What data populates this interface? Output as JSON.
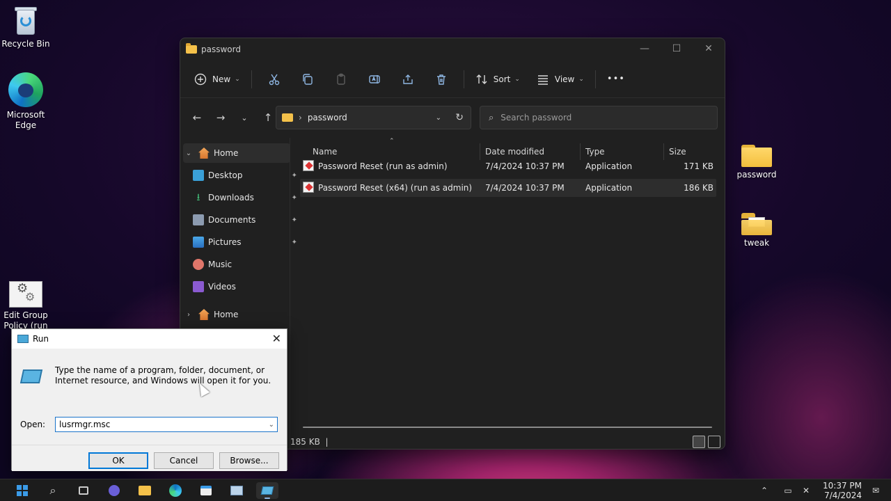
{
  "desktop": {
    "icons": [
      {
        "label": "Recycle Bin"
      },
      {
        "label": "Microsoft Edge"
      },
      {
        "label": "Edit Group Policy (run"
      },
      {
        "label": "password"
      },
      {
        "label": "tweak"
      }
    ]
  },
  "explorer": {
    "title": "password",
    "window_controls": {
      "minimize": "—",
      "maximize": "☐",
      "close": "✕"
    },
    "toolbar": {
      "new_label": "New",
      "sort_label": "Sort",
      "view_label": "View",
      "more_label": "•••"
    },
    "address": {
      "crumb": "password"
    },
    "search": {
      "placeholder": "Search password"
    },
    "sidebar": {
      "items": [
        {
          "label": "Home",
          "icon": "home-icon"
        },
        {
          "label": "Desktop",
          "icon": "desktop-icon"
        },
        {
          "label": "Downloads",
          "icon": "downloads-icon"
        },
        {
          "label": "Documents",
          "icon": "documents-icon"
        },
        {
          "label": "Pictures",
          "icon": "pictures-icon"
        },
        {
          "label": "Music",
          "icon": "music-icon"
        },
        {
          "label": "Videos",
          "icon": "videos-icon"
        },
        {
          "label": "Home",
          "icon": "home-icon"
        }
      ]
    },
    "columns": [
      "Name",
      "Date modified",
      "Type",
      "Size"
    ],
    "files": [
      {
        "name": "Password Reset (run as admin)",
        "date": "7/4/2024 10:37 PM",
        "type": "Application",
        "size": "171 KB"
      },
      {
        "name": "Password Reset (x64) (run as admin)",
        "date": "7/4/2024 10:37 PM",
        "type": "Application",
        "size": "186 KB"
      }
    ],
    "status": {
      "text": "185 KB  |"
    }
  },
  "run_dialog": {
    "title": "Run",
    "message": "Type the name of a program, folder, document, or Internet resource, and Windows will open it for you.",
    "open_label": "Open:",
    "input_value": "lusrmgr.msc",
    "ok_label": "OK",
    "cancel_label": "Cancel",
    "browse_label": "Browse..."
  },
  "taskbar": {
    "clock_time": "10:37 PM",
    "clock_date": "7/4/2024"
  },
  "colors": {
    "accent": "#0078d7",
    "explorer_bg": "#202020",
    "folder": "#f4c14a"
  }
}
